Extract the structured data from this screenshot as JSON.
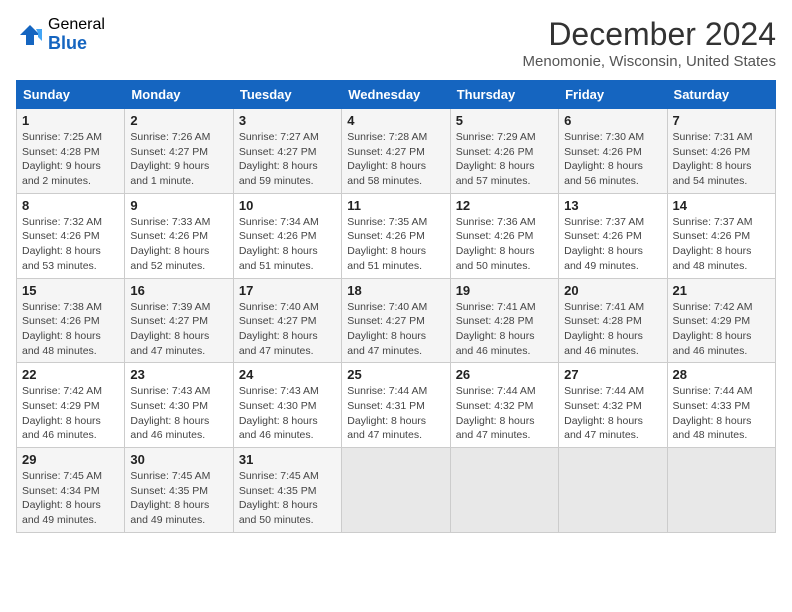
{
  "logo": {
    "general": "General",
    "blue": "Blue"
  },
  "title": "December 2024",
  "subtitle": "Menomonie, Wisconsin, United States",
  "days_of_week": [
    "Sunday",
    "Monday",
    "Tuesday",
    "Wednesday",
    "Thursday",
    "Friday",
    "Saturday"
  ],
  "weeks": [
    [
      {
        "day": "1",
        "sunrise": "Sunrise: 7:25 AM",
        "sunset": "Sunset: 4:28 PM",
        "daylight": "Daylight: 9 hours and 2 minutes."
      },
      {
        "day": "2",
        "sunrise": "Sunrise: 7:26 AM",
        "sunset": "Sunset: 4:27 PM",
        "daylight": "Daylight: 9 hours and 1 minute."
      },
      {
        "day": "3",
        "sunrise": "Sunrise: 7:27 AM",
        "sunset": "Sunset: 4:27 PM",
        "daylight": "Daylight: 8 hours and 59 minutes."
      },
      {
        "day": "4",
        "sunrise": "Sunrise: 7:28 AM",
        "sunset": "Sunset: 4:27 PM",
        "daylight": "Daylight: 8 hours and 58 minutes."
      },
      {
        "day": "5",
        "sunrise": "Sunrise: 7:29 AM",
        "sunset": "Sunset: 4:26 PM",
        "daylight": "Daylight: 8 hours and 57 minutes."
      },
      {
        "day": "6",
        "sunrise": "Sunrise: 7:30 AM",
        "sunset": "Sunset: 4:26 PM",
        "daylight": "Daylight: 8 hours and 56 minutes."
      },
      {
        "day": "7",
        "sunrise": "Sunrise: 7:31 AM",
        "sunset": "Sunset: 4:26 PM",
        "daylight": "Daylight: 8 hours and 54 minutes."
      }
    ],
    [
      {
        "day": "8",
        "sunrise": "Sunrise: 7:32 AM",
        "sunset": "Sunset: 4:26 PM",
        "daylight": "Daylight: 8 hours and 53 minutes."
      },
      {
        "day": "9",
        "sunrise": "Sunrise: 7:33 AM",
        "sunset": "Sunset: 4:26 PM",
        "daylight": "Daylight: 8 hours and 52 minutes."
      },
      {
        "day": "10",
        "sunrise": "Sunrise: 7:34 AM",
        "sunset": "Sunset: 4:26 PM",
        "daylight": "Daylight: 8 hours and 51 minutes."
      },
      {
        "day": "11",
        "sunrise": "Sunrise: 7:35 AM",
        "sunset": "Sunset: 4:26 PM",
        "daylight": "Daylight: 8 hours and 51 minutes."
      },
      {
        "day": "12",
        "sunrise": "Sunrise: 7:36 AM",
        "sunset": "Sunset: 4:26 PM",
        "daylight": "Daylight: 8 hours and 50 minutes."
      },
      {
        "day": "13",
        "sunrise": "Sunrise: 7:37 AM",
        "sunset": "Sunset: 4:26 PM",
        "daylight": "Daylight: 8 hours and 49 minutes."
      },
      {
        "day": "14",
        "sunrise": "Sunrise: 7:37 AM",
        "sunset": "Sunset: 4:26 PM",
        "daylight": "Daylight: 8 hours and 48 minutes."
      }
    ],
    [
      {
        "day": "15",
        "sunrise": "Sunrise: 7:38 AM",
        "sunset": "Sunset: 4:26 PM",
        "daylight": "Daylight: 8 hours and 48 minutes."
      },
      {
        "day": "16",
        "sunrise": "Sunrise: 7:39 AM",
        "sunset": "Sunset: 4:27 PM",
        "daylight": "Daylight: 8 hours and 47 minutes."
      },
      {
        "day": "17",
        "sunrise": "Sunrise: 7:40 AM",
        "sunset": "Sunset: 4:27 PM",
        "daylight": "Daylight: 8 hours and 47 minutes."
      },
      {
        "day": "18",
        "sunrise": "Sunrise: 7:40 AM",
        "sunset": "Sunset: 4:27 PM",
        "daylight": "Daylight: 8 hours and 47 minutes."
      },
      {
        "day": "19",
        "sunrise": "Sunrise: 7:41 AM",
        "sunset": "Sunset: 4:28 PM",
        "daylight": "Daylight: 8 hours and 46 minutes."
      },
      {
        "day": "20",
        "sunrise": "Sunrise: 7:41 AM",
        "sunset": "Sunset: 4:28 PM",
        "daylight": "Daylight: 8 hours and 46 minutes."
      },
      {
        "day": "21",
        "sunrise": "Sunrise: 7:42 AM",
        "sunset": "Sunset: 4:29 PM",
        "daylight": "Daylight: 8 hours and 46 minutes."
      }
    ],
    [
      {
        "day": "22",
        "sunrise": "Sunrise: 7:42 AM",
        "sunset": "Sunset: 4:29 PM",
        "daylight": "Daylight: 8 hours and 46 minutes."
      },
      {
        "day": "23",
        "sunrise": "Sunrise: 7:43 AM",
        "sunset": "Sunset: 4:30 PM",
        "daylight": "Daylight: 8 hours and 46 minutes."
      },
      {
        "day": "24",
        "sunrise": "Sunrise: 7:43 AM",
        "sunset": "Sunset: 4:30 PM",
        "daylight": "Daylight: 8 hours and 46 minutes."
      },
      {
        "day": "25",
        "sunrise": "Sunrise: 7:44 AM",
        "sunset": "Sunset: 4:31 PM",
        "daylight": "Daylight: 8 hours and 47 minutes."
      },
      {
        "day": "26",
        "sunrise": "Sunrise: 7:44 AM",
        "sunset": "Sunset: 4:32 PM",
        "daylight": "Daylight: 8 hours and 47 minutes."
      },
      {
        "day": "27",
        "sunrise": "Sunrise: 7:44 AM",
        "sunset": "Sunset: 4:32 PM",
        "daylight": "Daylight: 8 hours and 47 minutes."
      },
      {
        "day": "28",
        "sunrise": "Sunrise: 7:44 AM",
        "sunset": "Sunset: 4:33 PM",
        "daylight": "Daylight: 8 hours and 48 minutes."
      }
    ],
    [
      {
        "day": "29",
        "sunrise": "Sunrise: 7:45 AM",
        "sunset": "Sunset: 4:34 PM",
        "daylight": "Daylight: 8 hours and 49 minutes."
      },
      {
        "day": "30",
        "sunrise": "Sunrise: 7:45 AM",
        "sunset": "Sunset: 4:35 PM",
        "daylight": "Daylight: 8 hours and 49 minutes."
      },
      {
        "day": "31",
        "sunrise": "Sunrise: 7:45 AM",
        "sunset": "Sunset: 4:35 PM",
        "daylight": "Daylight: 8 hours and 50 minutes."
      },
      null,
      null,
      null,
      null
    ]
  ]
}
